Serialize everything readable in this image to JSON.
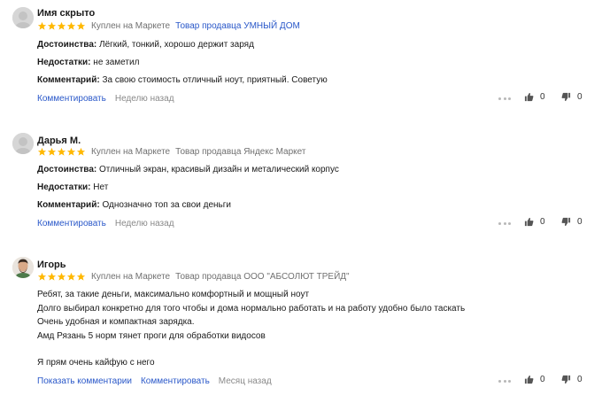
{
  "reviews": [
    {
      "name": "Имя скрыто",
      "bought": "Куплен на Маркете",
      "seller": "Товар продавца УМНЫЙ ДОМ",
      "seller_is_link": true,
      "pros_label": "Достоинства:",
      "pros": "Лёгкий, тонкий, хорошо держит заряд",
      "cons_label": "Недостатки:",
      "cons": "не заметил",
      "comment_label": "Комментарий:",
      "comment": "За свою стоимость отличный ноут, приятный. Советую",
      "comment_action": "Комментировать",
      "time": "Неделю назад",
      "likes": "0",
      "dislikes": "0",
      "rating": 5
    },
    {
      "name": "Дарья М.",
      "bought": "Куплен на Маркете",
      "seller": "Товар продавца Яндекс Маркет",
      "seller_is_link": false,
      "pros_label": "Достоинства:",
      "pros": "Отличный экран, красивый дизайн и металический корпус",
      "cons_label": "Недостатки:",
      "cons": "Нет",
      "comment_label": "Комментарий:",
      "comment": "Однозначно топ за свои деньги",
      "comment_action": "Комментировать",
      "time": "Неделю назад",
      "likes": "0",
      "dislikes": "0",
      "rating": 5
    },
    {
      "name": "Игорь",
      "bought": "Куплен на Маркете",
      "seller": "Товар продавца ООО \"АБСОЛЮТ ТРЕЙД\"",
      "seller_is_link": false,
      "lines": [
        "Ребят, за такие деньги, максимально комфортный и мощный ноут",
        "Долго выбирал конкретно для того чтобы и дома нормально работать и на работу удобно было таскать",
        "Очень удобная и компактная зарядка.",
        "Амд Рязань 5 норм тянет проги для обработки видосов",
        "",
        "Я прям очень кайфую с него"
      ],
      "show_comments": "Показать комментарии",
      "comment_action": "Комментировать",
      "time": "Месяц назад",
      "likes": "0",
      "dislikes": "0",
      "rating": 5
    }
  ],
  "colors": {
    "star": "#ffb800",
    "link": "#2a58c9",
    "muted": "#707070"
  },
  "icons": {
    "star": "star-icon",
    "more": "more-dots-icon",
    "like": "thumb-up-icon",
    "dislike": "thumb-down-icon",
    "avatar": "user-avatar-icon"
  }
}
